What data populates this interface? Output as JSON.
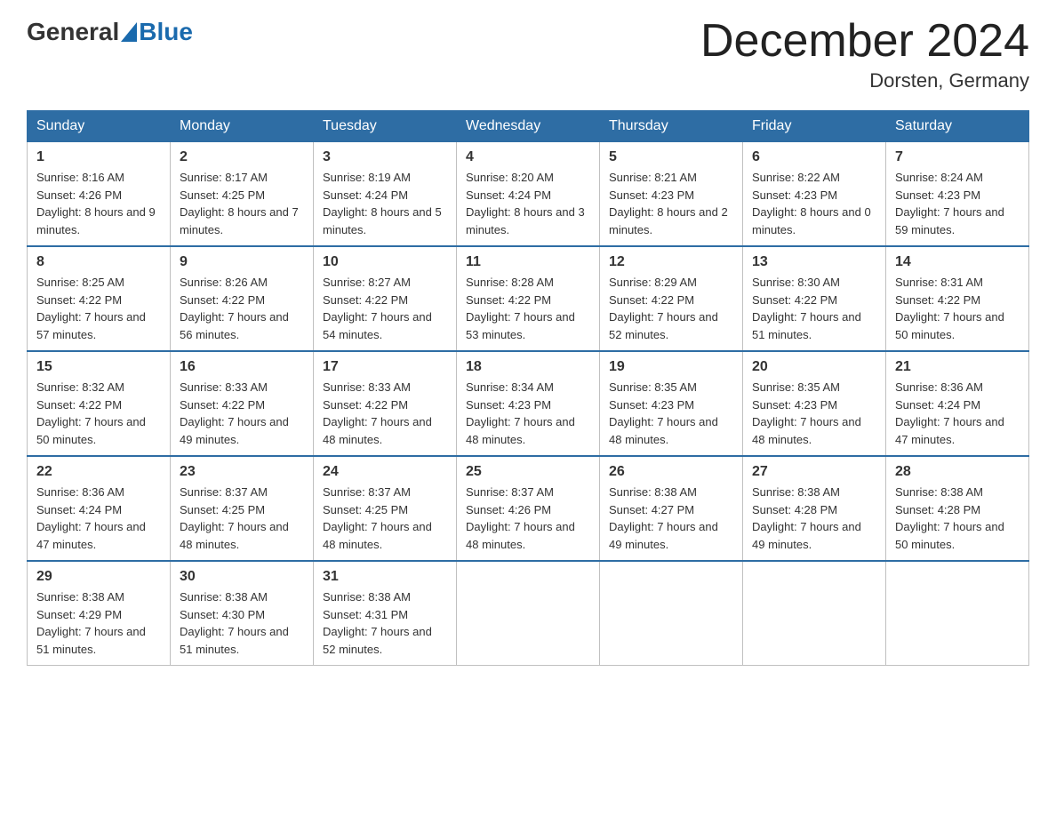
{
  "header": {
    "logo_general": "General",
    "logo_blue": "Blue",
    "month_title": "December 2024",
    "location": "Dorsten, Germany"
  },
  "weekdays": [
    "Sunday",
    "Monday",
    "Tuesday",
    "Wednesday",
    "Thursday",
    "Friday",
    "Saturday"
  ],
  "weeks": [
    [
      {
        "day": "1",
        "sunrise": "8:16 AM",
        "sunset": "4:26 PM",
        "daylight": "8 hours and 9 minutes."
      },
      {
        "day": "2",
        "sunrise": "8:17 AM",
        "sunset": "4:25 PM",
        "daylight": "8 hours and 7 minutes."
      },
      {
        "day": "3",
        "sunrise": "8:19 AM",
        "sunset": "4:24 PM",
        "daylight": "8 hours and 5 minutes."
      },
      {
        "day": "4",
        "sunrise": "8:20 AM",
        "sunset": "4:24 PM",
        "daylight": "8 hours and 3 minutes."
      },
      {
        "day": "5",
        "sunrise": "8:21 AM",
        "sunset": "4:23 PM",
        "daylight": "8 hours and 2 minutes."
      },
      {
        "day": "6",
        "sunrise": "8:22 AM",
        "sunset": "4:23 PM",
        "daylight": "8 hours and 0 minutes."
      },
      {
        "day": "7",
        "sunrise": "8:24 AM",
        "sunset": "4:23 PM",
        "daylight": "7 hours and 59 minutes."
      }
    ],
    [
      {
        "day": "8",
        "sunrise": "8:25 AM",
        "sunset": "4:22 PM",
        "daylight": "7 hours and 57 minutes."
      },
      {
        "day": "9",
        "sunrise": "8:26 AM",
        "sunset": "4:22 PM",
        "daylight": "7 hours and 56 minutes."
      },
      {
        "day": "10",
        "sunrise": "8:27 AM",
        "sunset": "4:22 PM",
        "daylight": "7 hours and 54 minutes."
      },
      {
        "day": "11",
        "sunrise": "8:28 AM",
        "sunset": "4:22 PM",
        "daylight": "7 hours and 53 minutes."
      },
      {
        "day": "12",
        "sunrise": "8:29 AM",
        "sunset": "4:22 PM",
        "daylight": "7 hours and 52 minutes."
      },
      {
        "day": "13",
        "sunrise": "8:30 AM",
        "sunset": "4:22 PM",
        "daylight": "7 hours and 51 minutes."
      },
      {
        "day": "14",
        "sunrise": "8:31 AM",
        "sunset": "4:22 PM",
        "daylight": "7 hours and 50 minutes."
      }
    ],
    [
      {
        "day": "15",
        "sunrise": "8:32 AM",
        "sunset": "4:22 PM",
        "daylight": "7 hours and 50 minutes."
      },
      {
        "day": "16",
        "sunrise": "8:33 AM",
        "sunset": "4:22 PM",
        "daylight": "7 hours and 49 minutes."
      },
      {
        "day": "17",
        "sunrise": "8:33 AM",
        "sunset": "4:22 PM",
        "daylight": "7 hours and 48 minutes."
      },
      {
        "day": "18",
        "sunrise": "8:34 AM",
        "sunset": "4:23 PM",
        "daylight": "7 hours and 48 minutes."
      },
      {
        "day": "19",
        "sunrise": "8:35 AM",
        "sunset": "4:23 PM",
        "daylight": "7 hours and 48 minutes."
      },
      {
        "day": "20",
        "sunrise": "8:35 AM",
        "sunset": "4:23 PM",
        "daylight": "7 hours and 48 minutes."
      },
      {
        "day": "21",
        "sunrise": "8:36 AM",
        "sunset": "4:24 PM",
        "daylight": "7 hours and 47 minutes."
      }
    ],
    [
      {
        "day": "22",
        "sunrise": "8:36 AM",
        "sunset": "4:24 PM",
        "daylight": "7 hours and 47 minutes."
      },
      {
        "day": "23",
        "sunrise": "8:37 AM",
        "sunset": "4:25 PM",
        "daylight": "7 hours and 48 minutes."
      },
      {
        "day": "24",
        "sunrise": "8:37 AM",
        "sunset": "4:25 PM",
        "daylight": "7 hours and 48 minutes."
      },
      {
        "day": "25",
        "sunrise": "8:37 AM",
        "sunset": "4:26 PM",
        "daylight": "7 hours and 48 minutes."
      },
      {
        "day": "26",
        "sunrise": "8:38 AM",
        "sunset": "4:27 PM",
        "daylight": "7 hours and 49 minutes."
      },
      {
        "day": "27",
        "sunrise": "8:38 AM",
        "sunset": "4:28 PM",
        "daylight": "7 hours and 49 minutes."
      },
      {
        "day": "28",
        "sunrise": "8:38 AM",
        "sunset": "4:28 PM",
        "daylight": "7 hours and 50 minutes."
      }
    ],
    [
      {
        "day": "29",
        "sunrise": "8:38 AM",
        "sunset": "4:29 PM",
        "daylight": "7 hours and 51 minutes."
      },
      {
        "day": "30",
        "sunrise": "8:38 AM",
        "sunset": "4:30 PM",
        "daylight": "7 hours and 51 minutes."
      },
      {
        "day": "31",
        "sunrise": "8:38 AM",
        "sunset": "4:31 PM",
        "daylight": "7 hours and 52 minutes."
      },
      null,
      null,
      null,
      null
    ]
  ]
}
